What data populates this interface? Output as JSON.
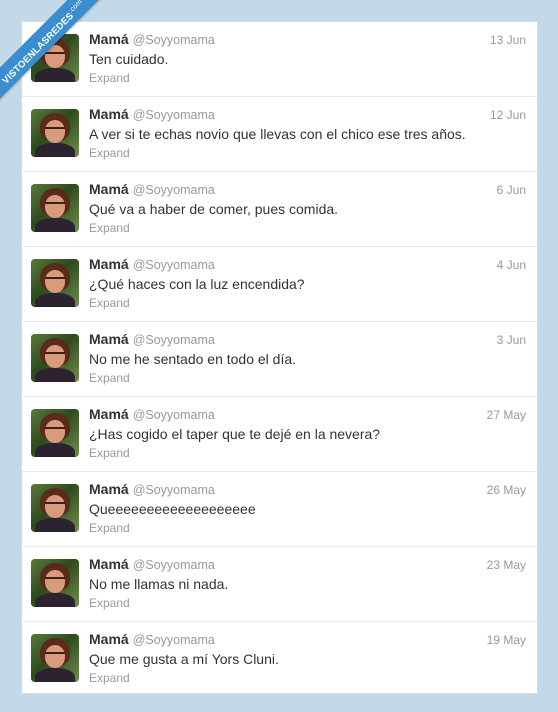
{
  "watermark": {
    "text": "VISTOENLASREDES",
    "suffix": ".com"
  },
  "tweets": [
    {
      "name": "Mamá",
      "handle": "@Soyyomama",
      "date": "13 Jun",
      "text": "Ten cuidado.",
      "expand": "Expand"
    },
    {
      "name": "Mamá",
      "handle": "@Soyyomama",
      "date": "12 Jun",
      "text": "A ver si te echas novio que llevas con el chico ese tres años.",
      "expand": "Expand"
    },
    {
      "name": "Mamá",
      "handle": "@Soyyomama",
      "date": "6 Jun",
      "text": "Qué va a haber de comer, pues comida.",
      "expand": "Expand"
    },
    {
      "name": "Mamá",
      "handle": "@Soyyomama",
      "date": "4 Jun",
      "text": "¿Qué haces con la luz encendida?",
      "expand": "Expand"
    },
    {
      "name": "Mamá",
      "handle": "@Soyyomama",
      "date": "3 Jun",
      "text": "No me he sentado en todo el día.",
      "expand": "Expand"
    },
    {
      "name": "Mamá",
      "handle": "@Soyyomama",
      "date": "27 May",
      "text": "¿Has cogido el taper que te dejé en la nevera?",
      "expand": "Expand"
    },
    {
      "name": "Mamá",
      "handle": "@Soyyomama",
      "date": "26 May",
      "text": "Queeeeeeeeeeeeeeeeeee",
      "expand": "Expand"
    },
    {
      "name": "Mamá",
      "handle": "@Soyyomama",
      "date": "23 May",
      "text": "No me llamas ni nada.",
      "expand": "Expand"
    },
    {
      "name": "Mamá",
      "handle": "@Soyyomama",
      "date": "19 May",
      "text": "Que me gusta a mí Yors Cluni.",
      "expand": "Expand"
    }
  ]
}
